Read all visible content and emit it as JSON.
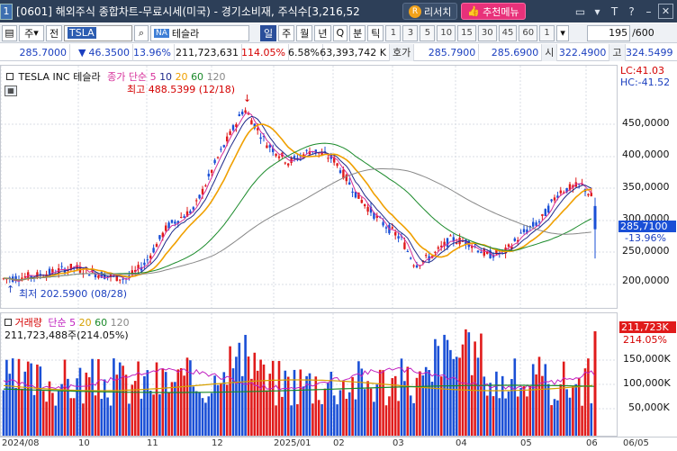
{
  "titlebar": {
    "number": "1",
    "title": "[0601] 해외주식 종합차트-무료시세(미국) - 경기소비재, 주식수[3,216,52",
    "research_label": "리서치",
    "recommend_label": "추천메뉴",
    "icons": [
      "window-icon",
      "pin-icon",
      "text-size-icon",
      "question-icon",
      "minimize-icon",
      "close-icon"
    ]
  },
  "toolbar": {
    "type_label": "주",
    "prev_label": "전",
    "code": "TSLA",
    "name_badge": "NA",
    "name": "테슬라",
    "periods": [
      "일",
      "주",
      "월",
      "년",
      "Q",
      "분",
      "틱"
    ],
    "selected_period": "일",
    "intervals": [
      "1",
      "3",
      "5",
      "10",
      "15",
      "30",
      "45",
      "60",
      "1"
    ],
    "count": "195",
    "total": "/600"
  },
  "quote": {
    "price": "285.7000",
    "change_arrow": "▼",
    "change": "46.3500",
    "change_pct": "13.96%",
    "volume": "211,723,631",
    "volume_pct": "114.05%",
    "turnover_pct": "6.58%",
    "amount": "63,393,742 K",
    "bid_label": "호가",
    "bid": "285.7900",
    "ask": "285.6900",
    "open_label": "시",
    "open": "322.4900",
    "high_label": "고",
    "high": "324.5499"
  },
  "price_chart": {
    "stock_label": "TESLA INC  테슬라",
    "ma_label": "종가 단순",
    "ma_periods": [
      "5",
      "10",
      "20",
      "60",
      "120"
    ],
    "ma_colors": [
      "#d6309a",
      "#1e2a8a",
      "#f0a000",
      "#1a8a2a",
      "#888888"
    ],
    "high_note": "최고 488.5399 (12/18)",
    "low_note": "최저 202.5900 (08/28)",
    "lc": "LC:41.03",
    "hc": "HC:-41.52",
    "y_ticks": [
      "450,0000",
      "400,0000",
      "350,0000",
      "300,0000",
      "250,0000",
      "200,0000"
    ],
    "last_price": "285,7100",
    "last_pct": "-13.96%"
  },
  "volume_chart": {
    "title": "거래량",
    "ma_label": "단순",
    "ma_periods": [
      "5",
      "20",
      "60",
      "120"
    ],
    "ma_colors": [
      "#c020c0",
      "#d6a000",
      "#1a8a2a",
      "#888888"
    ],
    "current": "211,723,488주(214.05%)",
    "y_ticks": [
      "150,000K",
      "100,000K",
      "50,000K"
    ],
    "last_vol": "211,723K",
    "last_pct": "214.05%"
  },
  "x_axis": [
    "2024/08",
    "10",
    "11",
    "12",
    "2025/01",
    "02",
    "03",
    "04",
    "05",
    "06",
    "06/05"
  ],
  "colors": {
    "up": "#e01b1b",
    "down": "#1a4fd6",
    "titlebar": "#2d3f58",
    "accent": "#2a4e9a"
  }
}
